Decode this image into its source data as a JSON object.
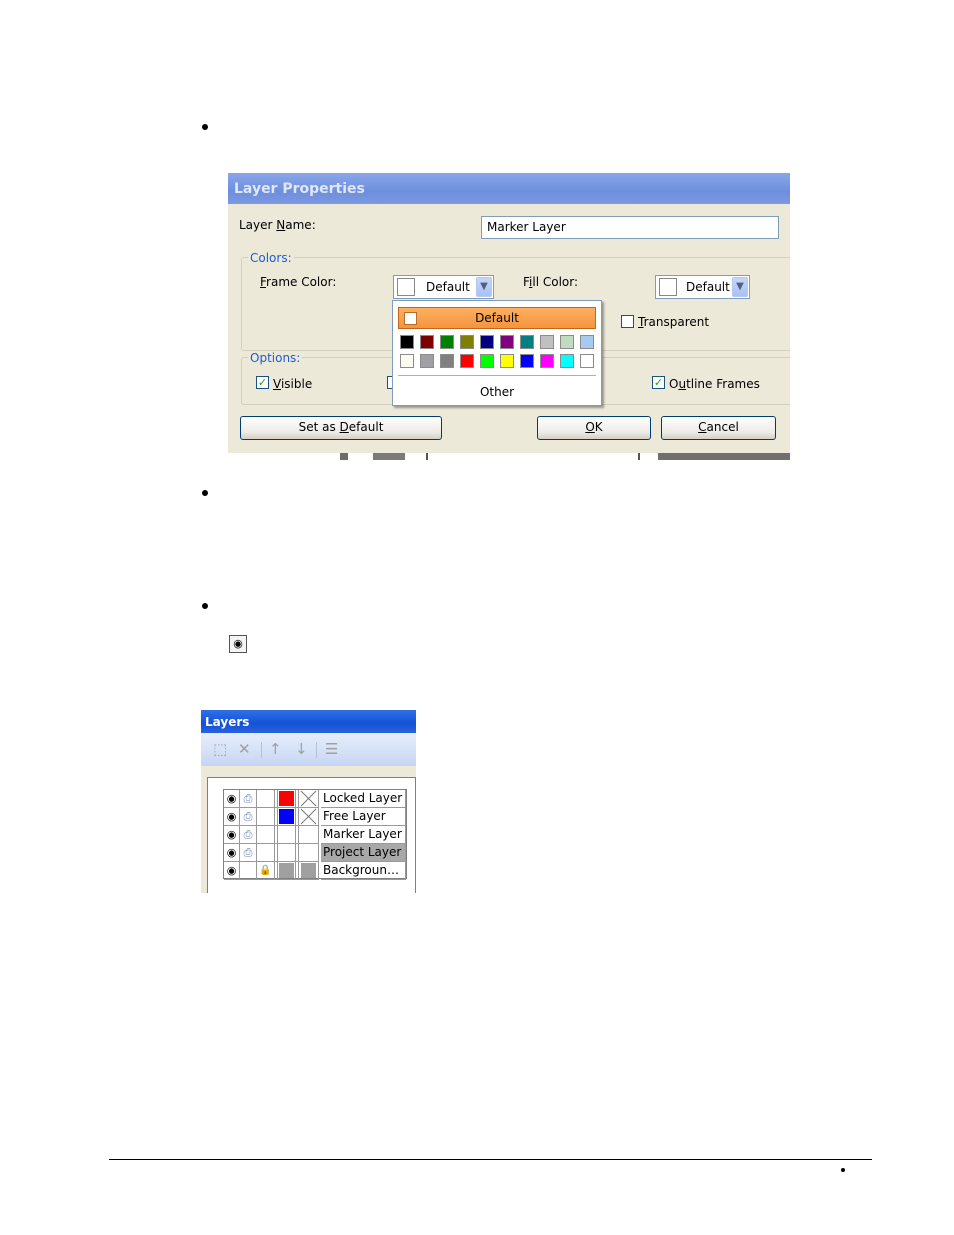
{
  "dialog": {
    "title": "Layer Properties",
    "layer_name_label": "Layer Name:",
    "layer_name_value": "Marker Layer",
    "colors_group": "Colors:",
    "frame_color_label": "Frame Color:",
    "frame_color_value": "Default",
    "fill_color_label": "Fill Color:",
    "fill_color_value": "Default",
    "transparent_label": "Transparent",
    "transparent_checked": false,
    "options_group": "Options:",
    "visible_label": "Visible",
    "visible_checked": true,
    "outline_frames_label": "Outline Frames",
    "outline_frames_checked": true,
    "set_default_button": "Set as Default",
    "ok_button": "OK",
    "cancel_button": "Cancel",
    "popup": {
      "default_label": "Default",
      "other_label": "Other",
      "row1": [
        "#000000",
        "#800000",
        "#008000",
        "#808000",
        "#000080",
        "#800080",
        "#008080",
        "#c0c0c0",
        "#c0dcc0",
        "#a6caf0"
      ],
      "row2": [
        "#fffbf0",
        "#a0a0a4",
        "#808080",
        "#ff0000",
        "#00ff00",
        "#ffff00",
        "#0000ff",
        "#ff00ff",
        "#00ffff",
        "#ffffff"
      ]
    }
  },
  "layers_panel": {
    "title": "Layers",
    "toolbar_icons": [
      "new-layer-icon",
      "delete-icon",
      "move-up-icon",
      "move-down-icon",
      "layer-properties-icon"
    ],
    "rows": [
      {
        "name": "Locked Layer",
        "frame": "#ff0000",
        "fill_crossed": true,
        "selected": false
      },
      {
        "name": "Free Layer",
        "frame": "#0000ff",
        "fill_crossed": true,
        "selected": false
      },
      {
        "name": "Marker Layer",
        "frame": "#ffffff",
        "fill_crossed": false,
        "selected": false
      },
      {
        "name": "Project Layer",
        "frame": "#ffffff",
        "fill_crossed": false,
        "selected": true
      },
      {
        "name": "Backgroun…",
        "frame": "#a0a0a0",
        "fill_crossed": false,
        "selected": false
      }
    ]
  }
}
